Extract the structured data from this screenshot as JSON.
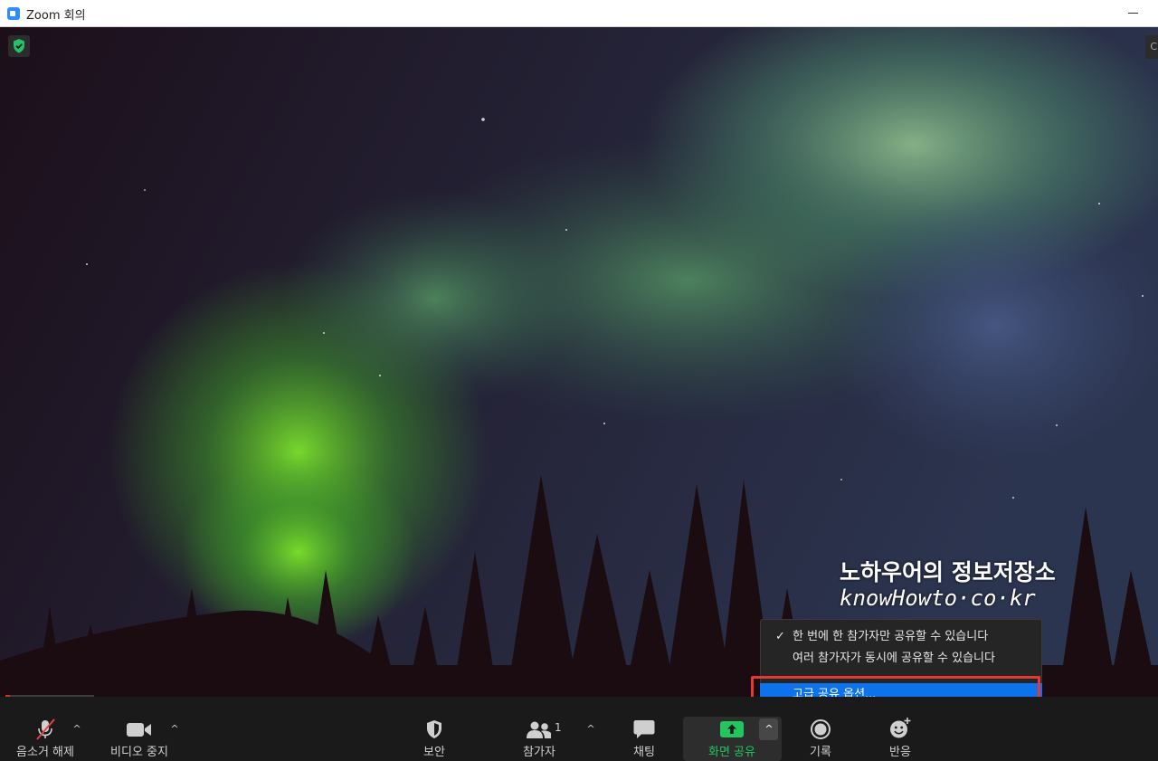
{
  "window": {
    "title": "Zoom 회의"
  },
  "video": {
    "right_chip_text": "C",
    "watermark": {
      "line1": "노하우어의 정보저장소",
      "line2": "knowHowto·co·kr"
    }
  },
  "share_menu": {
    "items": [
      {
        "label": "한 번에 한 참가자만 공유할 수 있습니다",
        "checked": true
      },
      {
        "label": "여러 참가자가 동시에 공유할 수 있습니다",
        "checked": false
      },
      {
        "label": "고급 공유 옵션...",
        "selected": true
      }
    ],
    "check_glyph": "✓",
    "highlight_color": "#0e72ed",
    "annotation_color": "#e53935"
  },
  "toolbar": {
    "unmute": {
      "label": "음소거 해제",
      "icon": "muted-mic-icon"
    },
    "stop_video": {
      "label": "비디오 중지",
      "icon": "video-camera-icon"
    },
    "security": {
      "label": "보안",
      "icon": "shield-icon"
    },
    "participants": {
      "label": "참가자",
      "count": "1",
      "icon": "participants-icon"
    },
    "chat": {
      "label": "채팅",
      "icon": "chat-bubble-icon"
    },
    "share_screen": {
      "label": "화면 공유",
      "icon": "share-screen-icon",
      "color": "#22c55e"
    },
    "record": {
      "label": "기록",
      "icon": "record-icon"
    },
    "reactions": {
      "label": "반응",
      "icon": "emoji-icon"
    },
    "caret_glyph": "^"
  }
}
